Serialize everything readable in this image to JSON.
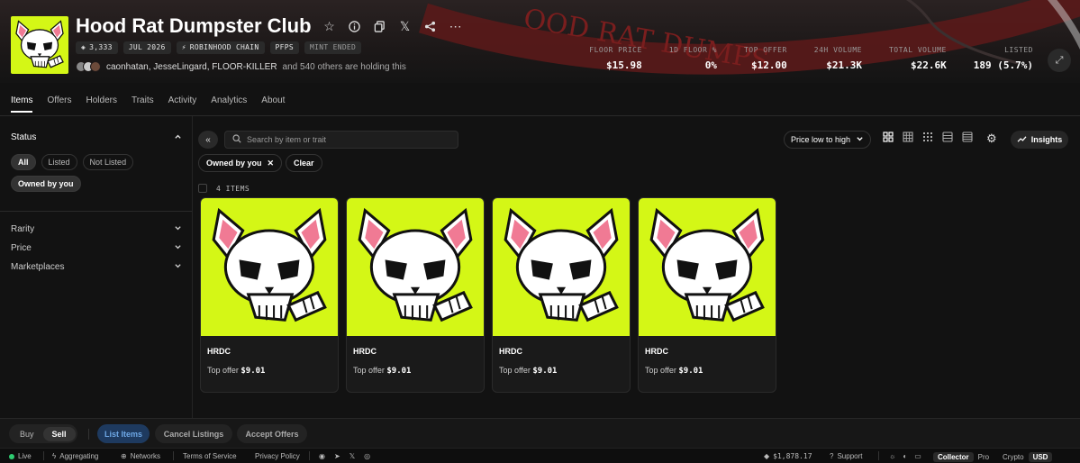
{
  "collection": {
    "title": "Hood Rat Dumpster Club",
    "banner_text": "OOD RAT DUMPS"
  },
  "chips": [
    {
      "icon": "layers-icon",
      "label": "3,333"
    },
    {
      "label": "JUL 2026"
    },
    {
      "icon": "chain-icon",
      "label": "ROBINHOOD CHAIN"
    },
    {
      "label": "PFPS"
    },
    {
      "label": "MINT ENDED"
    }
  ],
  "holders": {
    "names": "caonhatan, JesseLingard, FLOOR-KILLER",
    "suffix": "and 540 others are holding this"
  },
  "stats": [
    {
      "label": "FLOOR PRICE",
      "value": "$15.98"
    },
    {
      "label": "1D FLOOR %",
      "value": "0%"
    },
    {
      "label": "TOP OFFER",
      "value": "$12.00"
    },
    {
      "label": "24H VOLUME",
      "value": "$21.3K"
    },
    {
      "label": "TOTAL VOLUME",
      "value": "$22.6K"
    },
    {
      "label": "LISTED",
      "value": "189 (5.7%)"
    }
  ],
  "tabs": [
    "Items",
    "Offers",
    "Holders",
    "Traits",
    "Activity",
    "Analytics",
    "About"
  ],
  "sidebar": {
    "status_label": "Status",
    "status_options": [
      "All",
      "Listed",
      "Not Listed",
      "Owned by you"
    ],
    "filters": [
      "Rarity",
      "Price",
      "Marketplaces"
    ]
  },
  "toolbar": {
    "search_placeholder": "Search by item or trait",
    "sort_label": "Price low to high",
    "insights_label": "Insights"
  },
  "active_filter": {
    "label": "Owned by you",
    "clear_label": "Clear"
  },
  "items_count": "4 ITEMS",
  "items": [
    {
      "name": "HRDC",
      "offer_label": "Top offer",
      "offer_value": "$9.01"
    },
    {
      "name": "HRDC",
      "offer_label": "Top offer",
      "offer_value": "$9.01"
    },
    {
      "name": "HRDC",
      "offer_label": "Top offer",
      "offer_value": "$9.01"
    },
    {
      "name": "HRDC",
      "offer_label": "Top offer",
      "offer_value": "$9.01"
    }
  ],
  "actions": {
    "buy": "Buy",
    "sell": "Sell",
    "list_items": "List Items",
    "cancel_listings": "Cancel Listings",
    "accept_offers": "Accept Offers"
  },
  "statusbar": {
    "live": "Live",
    "aggregating": "Aggregating",
    "networks": "Networks",
    "terms": "Terms of Service",
    "privacy": "Privacy Policy",
    "eth_price": "$1,878.17",
    "support": "Support",
    "mode_collector": "Collector",
    "mode_pro": "Pro",
    "currency_crypto": "Crypto",
    "currency_usd": "USD"
  },
  "colors": {
    "accent": "#d4f716",
    "live": "#2ecc71",
    "primary_button": "#1e3a5f"
  }
}
